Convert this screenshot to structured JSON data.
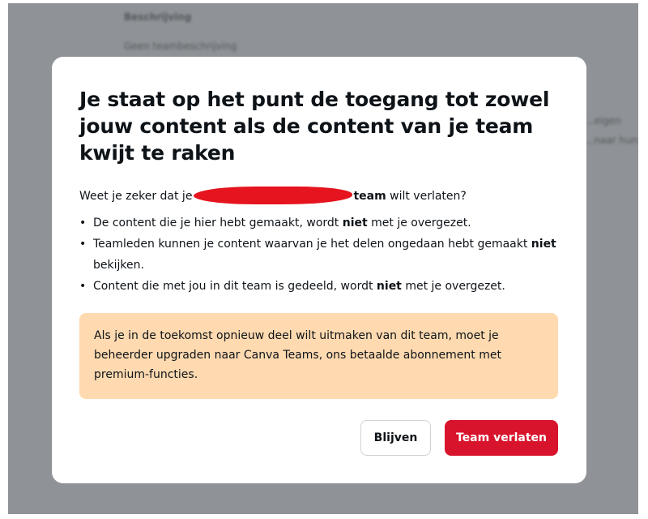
{
  "background": {
    "heading": "Beschrijving",
    "subheading": "Geen teambeschrijving",
    "right_line_1": "...eigen",
    "right_line_2": "...naar hun"
  },
  "dialog": {
    "title": "Je staat op het punt de toegang tot zowel jouw content als de content van je team kwijt te raken",
    "question_prefix": "Weet je zeker dat je",
    "question_team": "team",
    "question_suffix": " wilt verlaten?",
    "bullets": [
      {
        "before": "De content die je hier hebt gemaakt, wordt ",
        "bold": "niet",
        "after": " met je overgezet."
      },
      {
        "before": "Teamleden kunnen je content waarvan je het delen ongedaan hebt gemaakt ",
        "bold": "niet",
        "after": " bekijken."
      },
      {
        "before": "Content die met jou in dit team is gedeeld, wordt ",
        "bold": "niet",
        "after": " met je overgezet."
      }
    ],
    "notice": "Als je in de toekomst opnieuw deel wilt uitmaken van dit team, moet je beheerder upgraden naar Canva Teams, ons betaalde abonnement met premium-functies.",
    "stay_label": "Blijven",
    "leave_label": "Team verlaten"
  },
  "colors": {
    "overlay": "#8f9296",
    "notice_bg": "#ffdab0",
    "danger": "#d8142c",
    "redaction": "#e5141e"
  }
}
